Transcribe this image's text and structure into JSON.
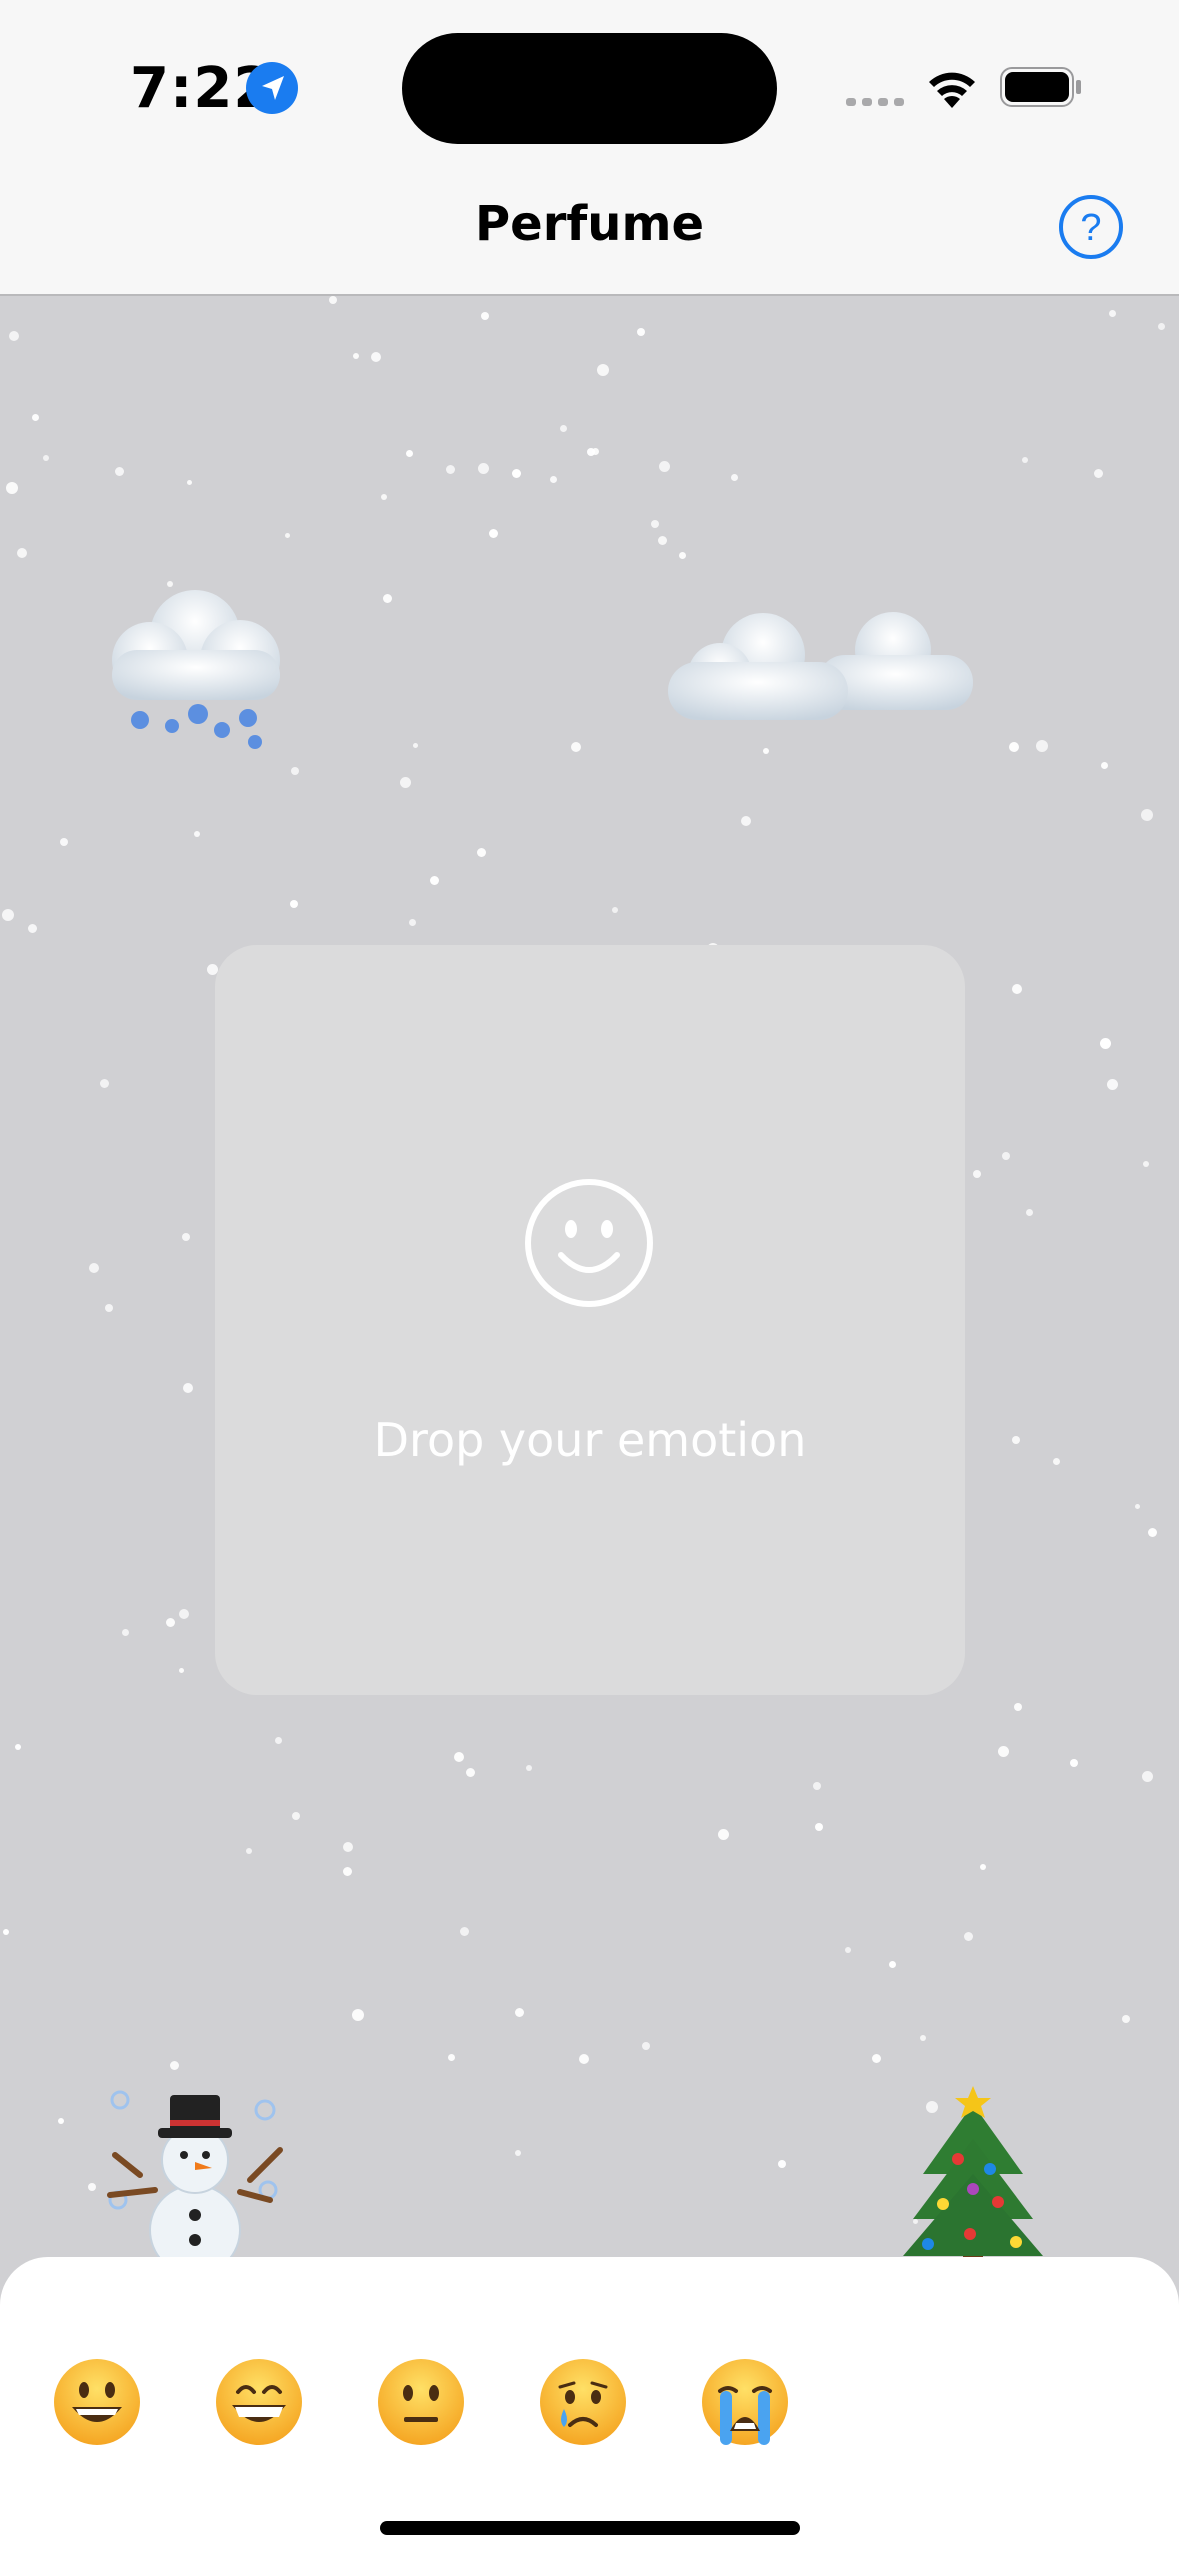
{
  "status_bar": {
    "time": "7:22",
    "location_icon": "location-arrow-icon",
    "wifi_icon": "wifi-icon",
    "battery_icon": "battery-full-icon",
    "accent_color": "#1a7cf0"
  },
  "nav": {
    "title": "Perfume",
    "help_icon": "help-circle-icon",
    "accent_color": "#1a7cf0"
  },
  "scene": {
    "top_left": "cloud-with-snow-emoji",
    "top_right": "two-clouds-emoji",
    "bottom_left": "snowman-with-snow-emoji",
    "bottom_right": "christmas-tree-emoji"
  },
  "drop_zone": {
    "icon": "smiley-face-outline-icon",
    "label": "Drop your emotion"
  },
  "emoji_tray": {
    "items": [
      {
        "name": "grinning-face-emoji"
      },
      {
        "name": "beaming-face-emoji"
      },
      {
        "name": "neutral-face-emoji"
      },
      {
        "name": "crying-face-emoji"
      },
      {
        "name": "loudly-crying-face-emoji"
      }
    ]
  }
}
